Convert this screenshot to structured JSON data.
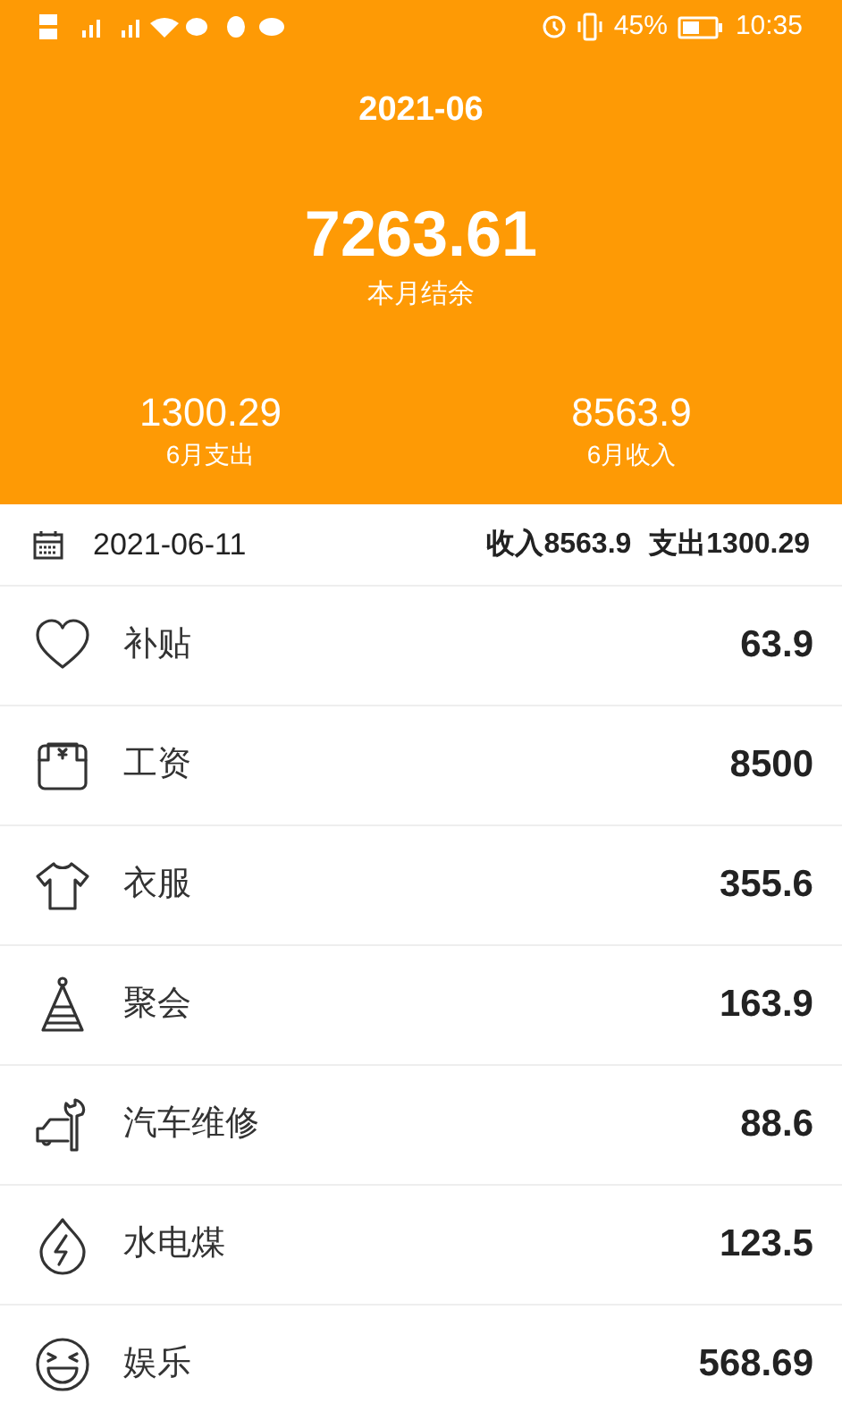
{
  "status_bar": {
    "battery": "45%",
    "time": "10:35"
  },
  "summary": {
    "month": "2021-06",
    "balance": "7263.61",
    "balance_label": "本月结余",
    "expense": "1300.29",
    "expense_label": "6月支出",
    "income": "8563.9",
    "income_label": "6月收入"
  },
  "day": {
    "date": "2021-06-11",
    "income": "收入8563.9",
    "expense": "支出1300.29"
  },
  "entries": [
    {
      "kind": "heart",
      "name": "补贴",
      "amount": "63.9"
    },
    {
      "kind": "wallet",
      "name": "工资",
      "amount": "8500"
    },
    {
      "kind": "shirt",
      "name": "衣服",
      "amount": "355.6"
    },
    {
      "kind": "party",
      "name": "聚会",
      "amount": "163.9"
    },
    {
      "kind": "car",
      "name": "汽车维修",
      "amount": "88.6"
    },
    {
      "kind": "utility",
      "name": "水电煤",
      "amount": "123.5"
    },
    {
      "kind": "fun",
      "name": "娱乐",
      "amount": "568.69"
    }
  ]
}
